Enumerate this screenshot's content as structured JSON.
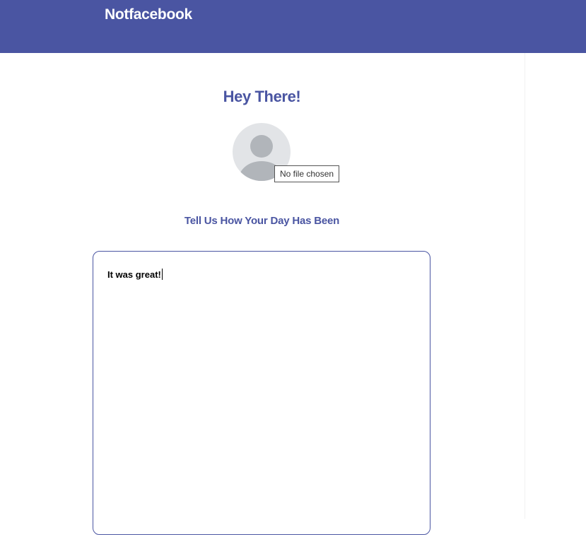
{
  "header": {
    "brand": "Notfacebook",
    "background_color": "#4a55a2"
  },
  "main": {
    "greeting": "Hey There!",
    "avatar_icon": "default-user-avatar-icon",
    "file_input": {
      "status_text": "No file chosen"
    },
    "prompt": "Tell Us How Your Day Has Been",
    "entry": {
      "value": "It was great!"
    }
  },
  "colors": {
    "accent": "#4a55a2",
    "avatar_bg": "#e2e4e7",
    "avatar_fg": "#b1b5ba"
  }
}
